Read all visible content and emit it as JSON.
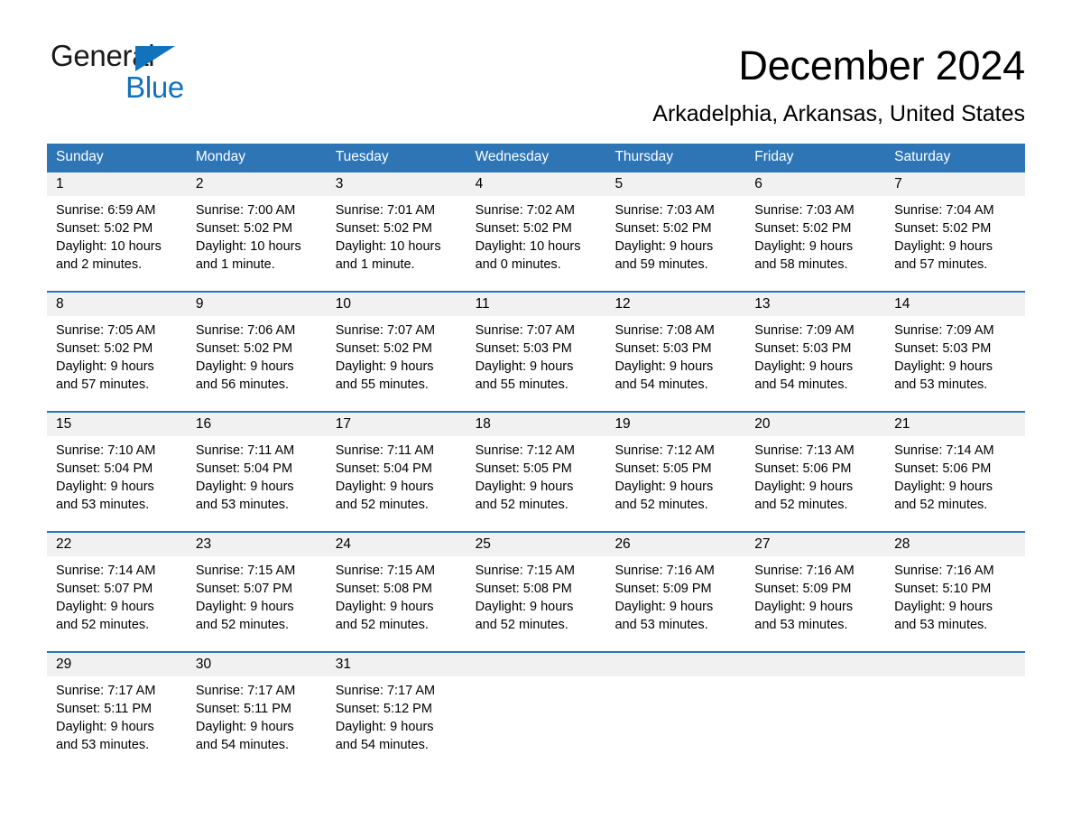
{
  "brand": {
    "name_top": "General",
    "name_bottom": "Blue",
    "accent_color": "#1272bb",
    "triangle_icon": "triangle-icon"
  },
  "header": {
    "month_title": "December 2024",
    "location": "Arkadelphia, Arkansas, United States"
  },
  "calendar": {
    "header_bg": "#2e75b6",
    "day_band_bg": "#f1f1f1",
    "weekdays": [
      "Sunday",
      "Monday",
      "Tuesday",
      "Wednesday",
      "Thursday",
      "Friday",
      "Saturday"
    ],
    "weeks": [
      {
        "days": [
          {
            "date": "1",
            "sunrise": "Sunrise: 6:59 AM",
            "sunset": "Sunset: 5:02 PM",
            "daylight_line1": "Daylight: 10 hours",
            "daylight_line2": "and 2 minutes."
          },
          {
            "date": "2",
            "sunrise": "Sunrise: 7:00 AM",
            "sunset": "Sunset: 5:02 PM",
            "daylight_line1": "Daylight: 10 hours",
            "daylight_line2": "and 1 minute."
          },
          {
            "date": "3",
            "sunrise": "Sunrise: 7:01 AM",
            "sunset": "Sunset: 5:02 PM",
            "daylight_line1": "Daylight: 10 hours",
            "daylight_line2": "and 1 minute."
          },
          {
            "date": "4",
            "sunrise": "Sunrise: 7:02 AM",
            "sunset": "Sunset: 5:02 PM",
            "daylight_line1": "Daylight: 10 hours",
            "daylight_line2": "and 0 minutes."
          },
          {
            "date": "5",
            "sunrise": "Sunrise: 7:03 AM",
            "sunset": "Sunset: 5:02 PM",
            "daylight_line1": "Daylight: 9 hours",
            "daylight_line2": "and 59 minutes."
          },
          {
            "date": "6",
            "sunrise": "Sunrise: 7:03 AM",
            "sunset": "Sunset: 5:02 PM",
            "daylight_line1": "Daylight: 9 hours",
            "daylight_line2": "and 58 minutes."
          },
          {
            "date": "7",
            "sunrise": "Sunrise: 7:04 AM",
            "sunset": "Sunset: 5:02 PM",
            "daylight_line1": "Daylight: 9 hours",
            "daylight_line2": "and 57 minutes."
          }
        ]
      },
      {
        "days": [
          {
            "date": "8",
            "sunrise": "Sunrise: 7:05 AM",
            "sunset": "Sunset: 5:02 PM",
            "daylight_line1": "Daylight: 9 hours",
            "daylight_line2": "and 57 minutes."
          },
          {
            "date": "9",
            "sunrise": "Sunrise: 7:06 AM",
            "sunset": "Sunset: 5:02 PM",
            "daylight_line1": "Daylight: 9 hours",
            "daylight_line2": "and 56 minutes."
          },
          {
            "date": "10",
            "sunrise": "Sunrise: 7:07 AM",
            "sunset": "Sunset: 5:02 PM",
            "daylight_line1": "Daylight: 9 hours",
            "daylight_line2": "and 55 minutes."
          },
          {
            "date": "11",
            "sunrise": "Sunrise: 7:07 AM",
            "sunset": "Sunset: 5:03 PM",
            "daylight_line1": "Daylight: 9 hours",
            "daylight_line2": "and 55 minutes."
          },
          {
            "date": "12",
            "sunrise": "Sunrise: 7:08 AM",
            "sunset": "Sunset: 5:03 PM",
            "daylight_line1": "Daylight: 9 hours",
            "daylight_line2": "and 54 minutes."
          },
          {
            "date": "13",
            "sunrise": "Sunrise: 7:09 AM",
            "sunset": "Sunset: 5:03 PM",
            "daylight_line1": "Daylight: 9 hours",
            "daylight_line2": "and 54 minutes."
          },
          {
            "date": "14",
            "sunrise": "Sunrise: 7:09 AM",
            "sunset": "Sunset: 5:03 PM",
            "daylight_line1": "Daylight: 9 hours",
            "daylight_line2": "and 53 minutes."
          }
        ]
      },
      {
        "days": [
          {
            "date": "15",
            "sunrise": "Sunrise: 7:10 AM",
            "sunset": "Sunset: 5:04 PM",
            "daylight_line1": "Daylight: 9 hours",
            "daylight_line2": "and 53 minutes."
          },
          {
            "date": "16",
            "sunrise": "Sunrise: 7:11 AM",
            "sunset": "Sunset: 5:04 PM",
            "daylight_line1": "Daylight: 9 hours",
            "daylight_line2": "and 53 minutes."
          },
          {
            "date": "17",
            "sunrise": "Sunrise: 7:11 AM",
            "sunset": "Sunset: 5:04 PM",
            "daylight_line1": "Daylight: 9 hours",
            "daylight_line2": "and 52 minutes."
          },
          {
            "date": "18",
            "sunrise": "Sunrise: 7:12 AM",
            "sunset": "Sunset: 5:05 PM",
            "daylight_line1": "Daylight: 9 hours",
            "daylight_line2": "and 52 minutes."
          },
          {
            "date": "19",
            "sunrise": "Sunrise: 7:12 AM",
            "sunset": "Sunset: 5:05 PM",
            "daylight_line1": "Daylight: 9 hours",
            "daylight_line2": "and 52 minutes."
          },
          {
            "date": "20",
            "sunrise": "Sunrise: 7:13 AM",
            "sunset": "Sunset: 5:06 PM",
            "daylight_line1": "Daylight: 9 hours",
            "daylight_line2": "and 52 minutes."
          },
          {
            "date": "21",
            "sunrise": "Sunrise: 7:14 AM",
            "sunset": "Sunset: 5:06 PM",
            "daylight_line1": "Daylight: 9 hours",
            "daylight_line2": "and 52 minutes."
          }
        ]
      },
      {
        "days": [
          {
            "date": "22",
            "sunrise": "Sunrise: 7:14 AM",
            "sunset": "Sunset: 5:07 PM",
            "daylight_line1": "Daylight: 9 hours",
            "daylight_line2": "and 52 minutes."
          },
          {
            "date": "23",
            "sunrise": "Sunrise: 7:15 AM",
            "sunset": "Sunset: 5:07 PM",
            "daylight_line1": "Daylight: 9 hours",
            "daylight_line2": "and 52 minutes."
          },
          {
            "date": "24",
            "sunrise": "Sunrise: 7:15 AM",
            "sunset": "Sunset: 5:08 PM",
            "daylight_line1": "Daylight: 9 hours",
            "daylight_line2": "and 52 minutes."
          },
          {
            "date": "25",
            "sunrise": "Sunrise: 7:15 AM",
            "sunset": "Sunset: 5:08 PM",
            "daylight_line1": "Daylight: 9 hours",
            "daylight_line2": "and 52 minutes."
          },
          {
            "date": "26",
            "sunrise": "Sunrise: 7:16 AM",
            "sunset": "Sunset: 5:09 PM",
            "daylight_line1": "Daylight: 9 hours",
            "daylight_line2": "and 53 minutes."
          },
          {
            "date": "27",
            "sunrise": "Sunrise: 7:16 AM",
            "sunset": "Sunset: 5:09 PM",
            "daylight_line1": "Daylight: 9 hours",
            "daylight_line2": "and 53 minutes."
          },
          {
            "date": "28",
            "sunrise": "Sunrise: 7:16 AM",
            "sunset": "Sunset: 5:10 PM",
            "daylight_line1": "Daylight: 9 hours",
            "daylight_line2": "and 53 minutes."
          }
        ]
      },
      {
        "days": [
          {
            "date": "29",
            "sunrise": "Sunrise: 7:17 AM",
            "sunset": "Sunset: 5:11 PM",
            "daylight_line1": "Daylight: 9 hours",
            "daylight_line2": "and 53 minutes."
          },
          {
            "date": "30",
            "sunrise": "Sunrise: 7:17 AM",
            "sunset": "Sunset: 5:11 PM",
            "daylight_line1": "Daylight: 9 hours",
            "daylight_line2": "and 54 minutes."
          },
          {
            "date": "31",
            "sunrise": "Sunrise: 7:17 AM",
            "sunset": "Sunset: 5:12 PM",
            "daylight_line1": "Daylight: 9 hours",
            "daylight_line2": "and 54 minutes."
          },
          {
            "date": "",
            "sunrise": "",
            "sunset": "",
            "daylight_line1": "",
            "daylight_line2": ""
          },
          {
            "date": "",
            "sunrise": "",
            "sunset": "",
            "daylight_line1": "",
            "daylight_line2": ""
          },
          {
            "date": "",
            "sunrise": "",
            "sunset": "",
            "daylight_line1": "",
            "daylight_line2": ""
          },
          {
            "date": "",
            "sunrise": "",
            "sunset": "",
            "daylight_line1": "",
            "daylight_line2": ""
          }
        ]
      }
    ]
  }
}
